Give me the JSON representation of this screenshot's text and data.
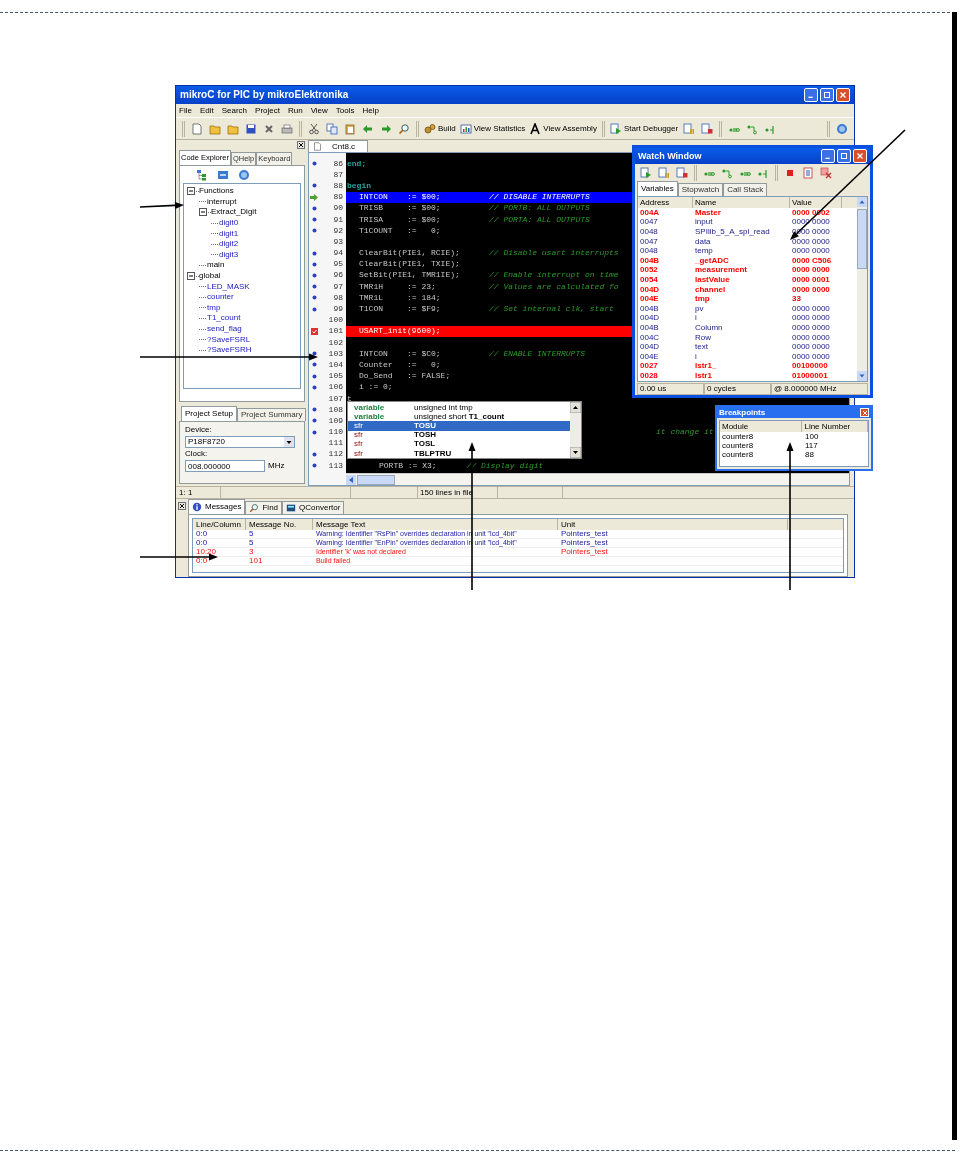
{
  "window": {
    "title": "mikroC for PIC by mikroElektronika"
  },
  "menu": [
    "File",
    "Edit",
    "Search",
    "Project",
    "Run",
    "View",
    "Tools",
    "Help"
  ],
  "toolbar": {
    "build": "Build",
    "statistics": "View Statistics",
    "assembly": "View Assembly",
    "debugger": "Start Debugger"
  },
  "left_panel": {
    "tabs": [
      {
        "label": "Code Explorer",
        "selected": true
      },
      {
        "label": "QHelp",
        "selected": false
      },
      {
        "label": "Keyboard",
        "selected": false
      }
    ],
    "tree": [
      {
        "label": "Functions",
        "expanded": true,
        "children": [
          {
            "label": "interrupt",
            "kind": "function"
          },
          {
            "label": "Extract_Digit",
            "kind": "function",
            "expanded": true,
            "children": [
              {
                "label": "digit0",
                "kind": "variable"
              },
              {
                "label": "digit1",
                "kind": "variable"
              },
              {
                "label": "digit2",
                "kind": "variable"
              },
              {
                "label": "digit3",
                "kind": "variable"
              }
            ]
          },
          {
            "label": "main",
            "kind": "function"
          }
        ]
      },
      {
        "label": "global",
        "expanded": true,
        "children": [
          {
            "label": "LED_MASK",
            "kind": "variable"
          },
          {
            "label": "counter",
            "kind": "variable"
          },
          {
            "label": "tmp",
            "kind": "variable"
          },
          {
            "label": "T1_count",
            "kind": "variable"
          },
          {
            "label": "send_flag",
            "kind": "variable"
          },
          {
            "label": "?SaveFSRL",
            "kind": "variable"
          },
          {
            "label": "?SaveFSRH",
            "kind": "variable"
          }
        ]
      }
    ],
    "setup_tabs": [
      {
        "label": "Project Setup",
        "selected": true
      },
      {
        "label": "Project Summary",
        "selected": false
      }
    ],
    "device": {
      "label": "Device:",
      "value": "P18F8720"
    },
    "clock": {
      "label": "Clock:",
      "value": "008.000000",
      "unit": "MHz"
    }
  },
  "editor": {
    "file_tab": "Cnt8.c",
    "lines": [
      {
        "number": "86",
        "dot": true,
        "kind": "keyword",
        "code": "end;"
      },
      {
        "number": "87",
        "dot": false,
        "kind": "code"
      },
      {
        "number": "88",
        "dot": true,
        "kind": "keyword",
        "code": "begin"
      },
      {
        "number": "89",
        "dot": false,
        "kind": "current",
        "code": "INTCON    := $00;",
        "comment": "// DISABLE INTERRUPTS"
      },
      {
        "number": "90",
        "dot": true,
        "kind": "code",
        "code": "TRISB     := $00;",
        "comment": "// PORTB: ALL OUTPUTS"
      },
      {
        "number": "91",
        "dot": true,
        "kind": "code",
        "code": "TRISA     := $00;",
        "comment": "// PORTA: ALL OUTPUTS"
      },
      {
        "number": "92",
        "dot": true,
        "kind": "code",
        "code": "T1COUNT   :=   0;"
      },
      {
        "number": "93",
        "dot": false,
        "kind": "code"
      },
      {
        "number": "94",
        "dot": true,
        "kind": "code",
        "code": "ClearBit(PIE1, RCIE);",
        "comment": "// Disable usart interrupts"
      },
      {
        "number": "95",
        "dot": true,
        "kind": "code",
        "code": "ClearBit(PIE1, TXIE);"
      },
      {
        "number": "96",
        "dot": true,
        "kind": "code",
        "code": "SetBit(PIE1, TMR1IE);",
        "comment": "// Enable interrupt on time"
      },
      {
        "number": "97",
        "dot": true,
        "kind": "code",
        "code": "TMR1H     := 23;",
        "comment": "// Values are calculated fo"
      },
      {
        "number": "98",
        "dot": true,
        "kind": "code",
        "code": "TMR1L     := 184;"
      },
      {
        "number": "99",
        "dot": true,
        "kind": "code",
        "code": "T1CON     := $F9;",
        "comment": "// Set internal clk, start"
      },
      {
        "number": "100",
        "dot": false,
        "kind": "code"
      },
      {
        "number": "101",
        "dot": false,
        "kind": "breakpoint",
        "code": "USART_init(9600);"
      },
      {
        "number": "102",
        "dot": false,
        "kind": "code"
      },
      {
        "number": "103",
        "dot": true,
        "kind": "code",
        "code": "INTCON    := $C0;",
        "comment": "// ENABLE INTERRUPTS"
      },
      {
        "number": "104",
        "dot": true,
        "kind": "code",
        "code": "Counter   :=   0;"
      },
      {
        "number": "105",
        "dot": true,
        "kind": "code",
        "code": "Do_Send   := FALSE;"
      },
      {
        "number": "106",
        "dot": true,
        "kind": "code",
        "code": "i := 0;"
      },
      {
        "number": "107",
        "dot": false,
        "kind": "typing",
        "code": "t"
      },
      {
        "number": "108",
        "dot": true,
        "kind": "code"
      },
      {
        "number": "109",
        "dot": true,
        "kind": "code"
      },
      {
        "number": "110",
        "dot": true,
        "kind": "tail",
        "comment": "it change it"
      },
      {
        "number": "111",
        "dot": false,
        "kind": "code"
      },
      {
        "number": "112",
        "dot": true,
        "kind": "code"
      },
      {
        "number": "113",
        "dot": true,
        "kind": "indented",
        "code": "PORTB := X3;",
        "comment": "// Display digit"
      }
    ]
  },
  "autocomplete": {
    "items": [
      {
        "category": "variable",
        "kind": "variable",
        "detail": "unsigned int tmp",
        "selected": false
      },
      {
        "category": "variable",
        "kind": "variable",
        "detail": "unsigned short **T1_count**",
        "selected": false
      },
      {
        "category": "sfr",
        "kind": "sfr",
        "detail": "TOSU",
        "selected": true
      },
      {
        "category": "sfr",
        "kind": "sfr",
        "detail": "TOSH",
        "selected": false
      },
      {
        "category": "sfr",
        "kind": "sfr",
        "detail": "TOSL",
        "selected": false
      },
      {
        "category": "sfr",
        "kind": "sfr",
        "detail": "TBLPTRU",
        "selected": false
      }
    ]
  },
  "watch_window": {
    "title": "Watch Window",
    "tabs": [
      {
        "label": "Variables",
        "selected": true
      },
      {
        "label": "Stopwatch",
        "selected": false
      },
      {
        "label": "Call Stack",
        "selected": false
      }
    ],
    "columns": [
      "Address",
      "Name",
      "Value"
    ],
    "rows": [
      {
        "address": "004A",
        "name": "Master",
        "value": "0000 0002",
        "changed": true
      },
      {
        "address": "0047",
        "name": "input",
        "value": "0000 0000",
        "changed": false
      },
      {
        "address": "0048",
        "name": "SPIlib_5_A_spi_read",
        "value": "0000 0000",
        "changed": false
      },
      {
        "address": "0047",
        "name": "data",
        "value": "0000 0000",
        "changed": false
      },
      {
        "address": "0048",
        "name": "temp",
        "value": "0000 0000",
        "changed": false
      },
      {
        "address": "004B",
        "name": "_getADC",
        "value": "0000 C506",
        "changed": true
      },
      {
        "address": "0052",
        "name": "measurement",
        "value": "0000 0000",
        "changed": true
      },
      {
        "address": "0054",
        "name": "lastValue",
        "value": "0000 0001",
        "changed": true
      },
      {
        "address": "004D",
        "name": "channel",
        "value": "0000 0000",
        "changed": true
      },
      {
        "address": "004E",
        "name": "tmp",
        "value": "33",
        "changed": true
      },
      {
        "address": "004B",
        "name": "pv",
        "value": "0000 0000",
        "changed": false
      },
      {
        "address": "004D",
        "name": "i",
        "value": "0000 0000",
        "changed": false
      },
      {
        "address": "004B",
        "name": "Column",
        "value": "0000 0000",
        "changed": false
      },
      {
        "address": "004C",
        "name": "Row",
        "value": "0000 0000",
        "changed": false
      },
      {
        "address": "004D",
        "name": "text",
        "value": "0000 0000",
        "changed": false
      },
      {
        "address": "004E",
        "name": "i",
        "value": "0000 0000",
        "changed": false
      },
      {
        "address": "0027",
        "name": "lstr1_",
        "value": "00100000",
        "changed": true
      },
      {
        "address": "0028",
        "name": "lstr1",
        "value": "01000001",
        "changed": true
      }
    ],
    "status": [
      "0.00 us",
      "0 cycles",
      "@ 8.000000 MHz"
    ]
  },
  "breakpoints": {
    "title": "Breakpoints",
    "columns": [
      "Module",
      "Line Number"
    ],
    "rows": [
      {
        "module": "counter8",
        "line": "100"
      },
      {
        "module": "counter8",
        "line": "117"
      },
      {
        "module": "counter8",
        "line": "88"
      }
    ]
  },
  "status_bar": [
    "1: 1",
    "150 lines in file"
  ],
  "messages": {
    "tabs": [
      {
        "label": "Messages",
        "selected": true
      },
      {
        "label": "Find",
        "selected": false
      },
      {
        "label": "QConvertor",
        "selected": false
      }
    ],
    "columns": [
      "Line/Column",
      "Message No.",
      "Message Text",
      "Unit"
    ],
    "rows": [
      {
        "line_column": "0:0",
        "number": "5",
        "text": "Warning: Identifier \"RsPin\" overrides declaration in unit \"lcd_4bit\"",
        "unit": "Pointers_test",
        "error": false
      },
      {
        "line_column": "0:0",
        "number": "5",
        "text": "Warning: Identifier \"EnPin\" overrides declaration in unit \"lcd_4bit\"",
        "unit": "Pointers_test",
        "error": false
      },
      {
        "line_column": "10:20",
        "number": "3",
        "text": "Identifier 'k' was not declared",
        "unit": "Pointers_test",
        "error": true
      },
      {
        "line_column": "0:0",
        "number": "101",
        "text": "Build failed",
        "error": true
      }
    ]
  }
}
